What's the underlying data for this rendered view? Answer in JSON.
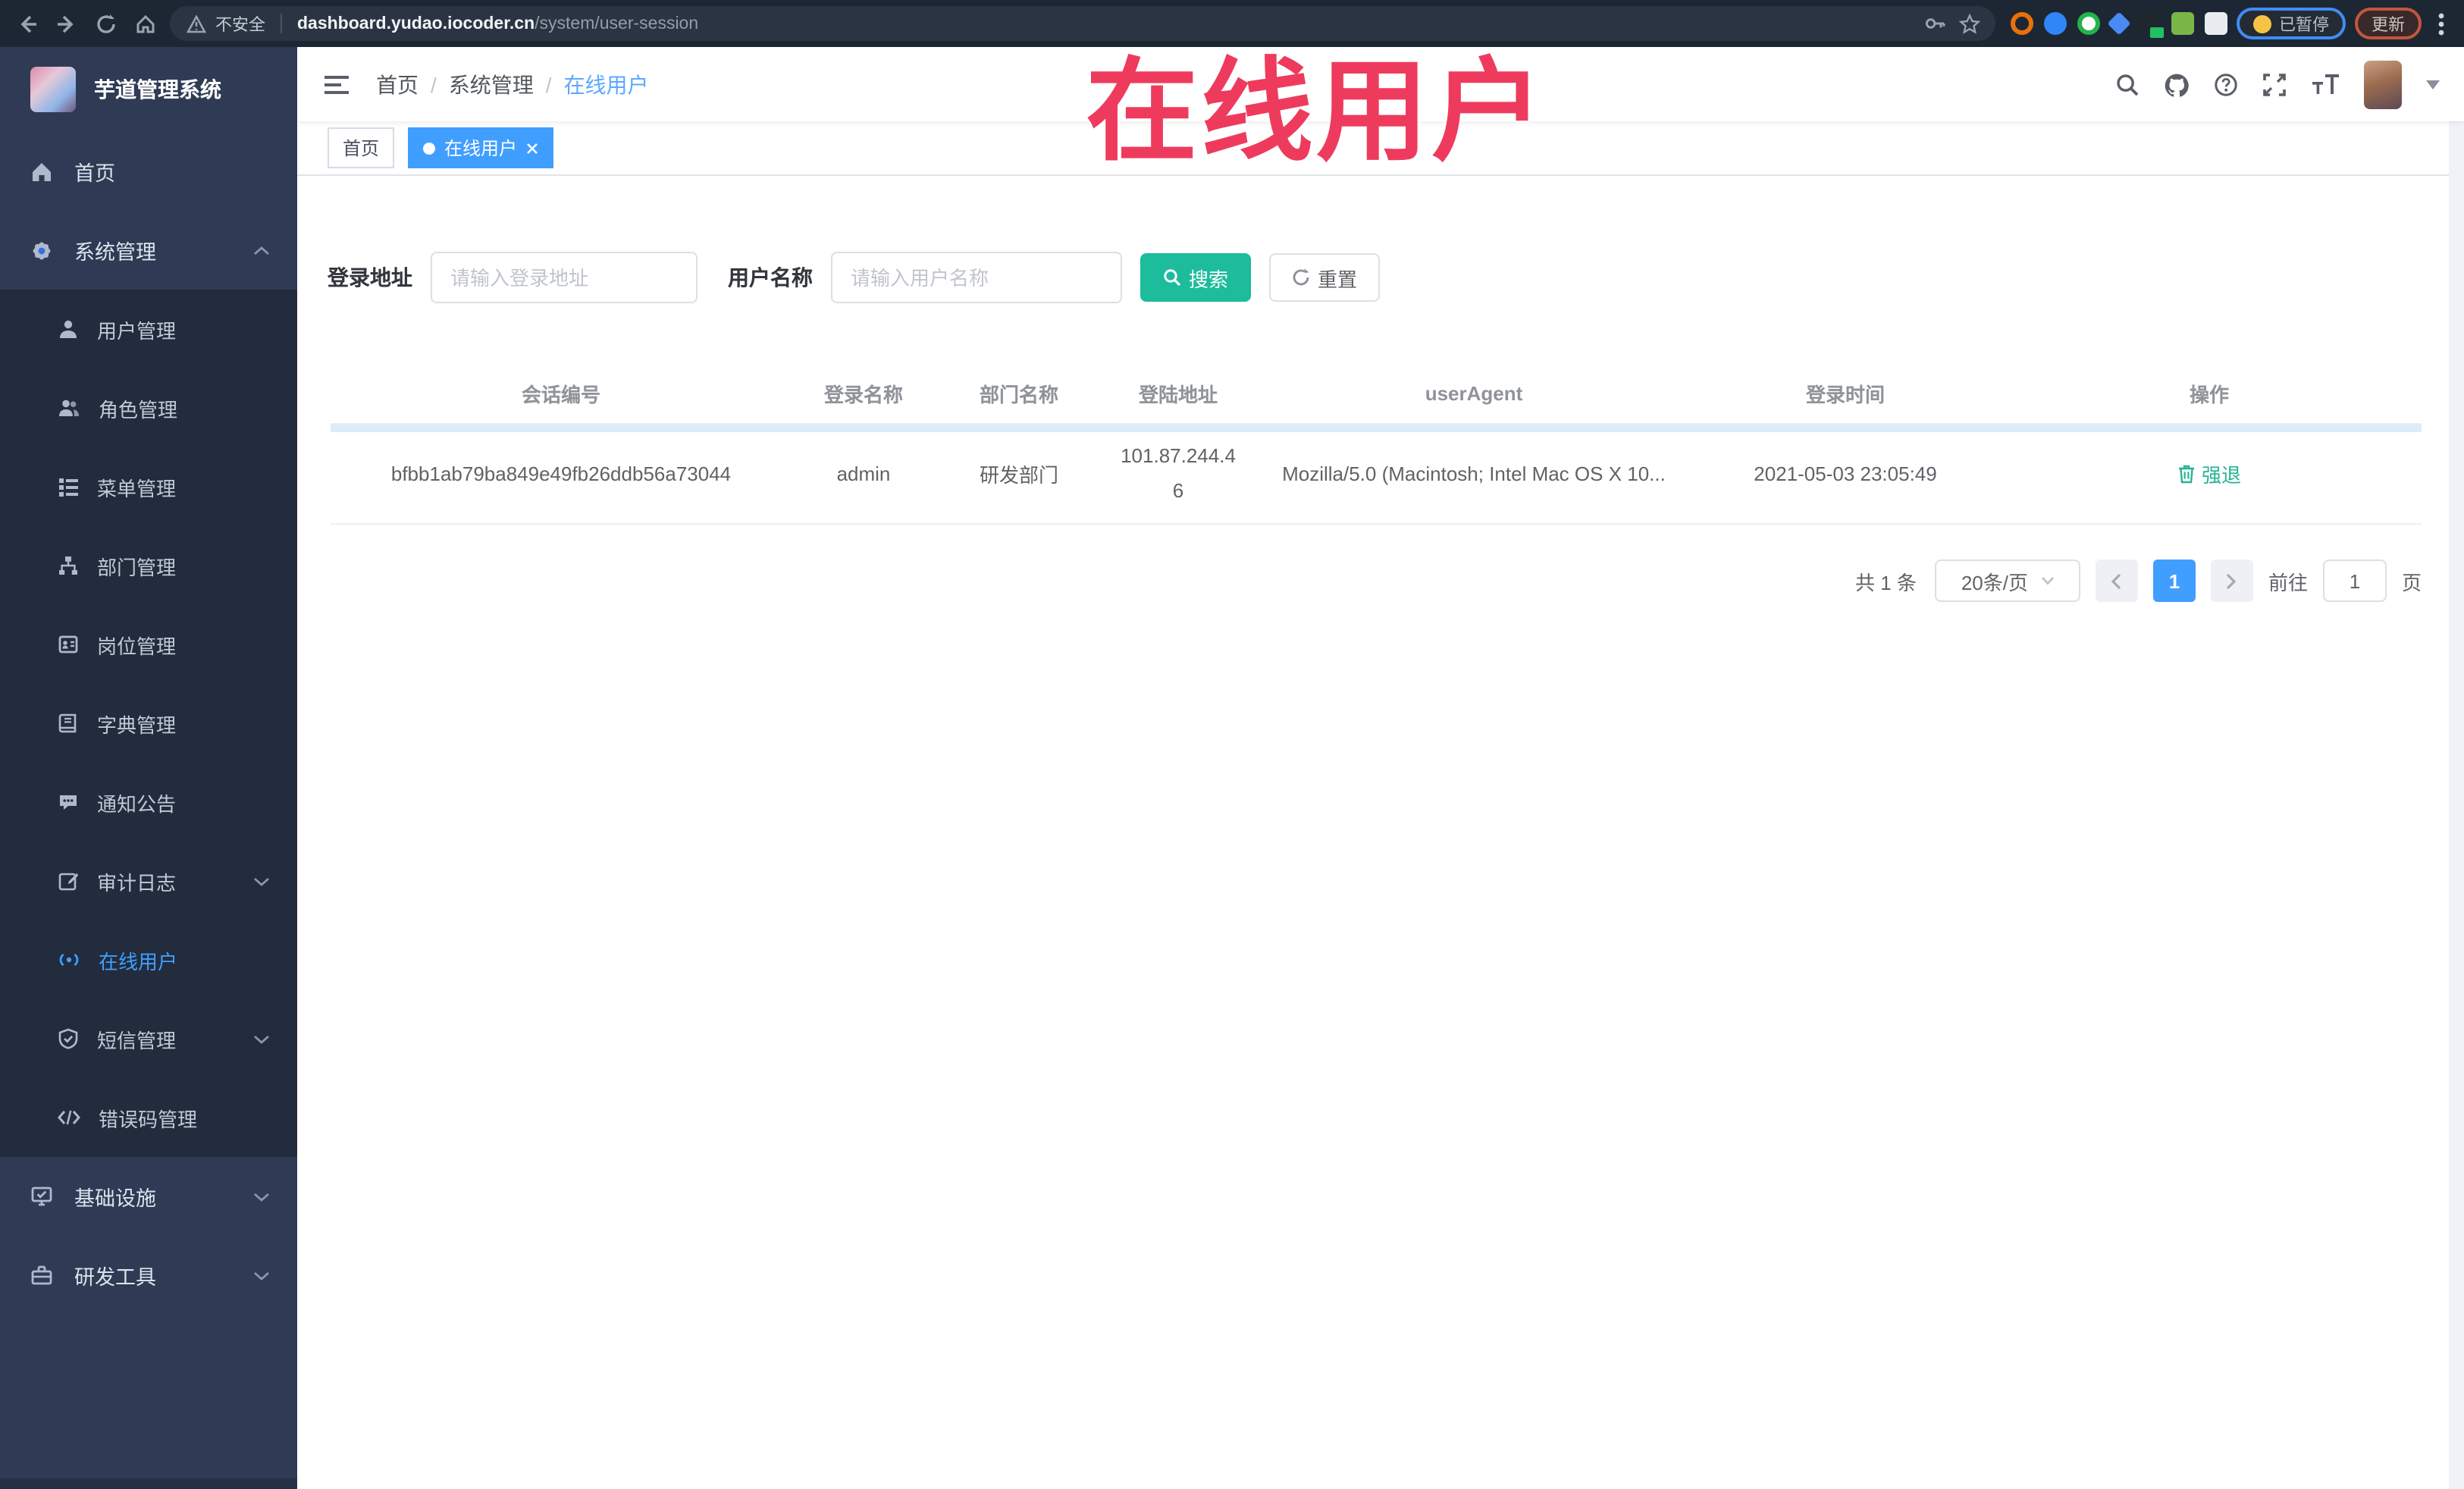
{
  "browser": {
    "security_label": "不安全",
    "url_domain": "dashboard.yudao.iocoder.cn",
    "url_path": "/system/user-session",
    "paused_label": "已暂停",
    "update_label": "更新"
  },
  "annotation": {
    "text": "在线用户",
    "color": "#ee3b5d"
  },
  "sidebar": {
    "title": "芋道管理系统",
    "items": [
      {
        "label": "首页",
        "icon": "home-icon",
        "level": "top"
      },
      {
        "label": "系统管理",
        "icon": "gear-icon",
        "level": "top",
        "chevron": "up"
      },
      {
        "label": "用户管理",
        "icon": "user-icon",
        "level": "sub"
      },
      {
        "label": "角色管理",
        "icon": "users-icon",
        "level": "sub"
      },
      {
        "label": "菜单管理",
        "icon": "menu-list-icon",
        "level": "sub"
      },
      {
        "label": "部门管理",
        "icon": "org-tree-icon",
        "level": "sub"
      },
      {
        "label": "岗位管理",
        "icon": "id-badge-icon",
        "level": "sub"
      },
      {
        "label": "字典管理",
        "icon": "dictionary-icon",
        "level": "sub"
      },
      {
        "label": "通知公告",
        "icon": "announcement-icon",
        "level": "sub"
      },
      {
        "label": "审计日志",
        "icon": "audit-log-icon",
        "level": "sub",
        "chevron": "down"
      },
      {
        "label": "在线用户",
        "icon": "online-user-icon",
        "level": "sub",
        "active": true
      },
      {
        "label": "短信管理",
        "icon": "sms-icon",
        "level": "sub",
        "chevron": "down"
      },
      {
        "label": "错误码管理",
        "icon": "error-code-icon",
        "level": "sub"
      },
      {
        "label": "基础设施",
        "icon": "infrastructure-icon",
        "level": "top",
        "chevron": "down"
      },
      {
        "label": "研发工具",
        "icon": "dev-tools-icon",
        "level": "top",
        "chevron": "down"
      }
    ]
  },
  "header": {
    "breadcrumb": [
      "首页",
      "系统管理",
      "在线用户"
    ],
    "breadcrumb_sep": "/"
  },
  "tags": {
    "home_label": "首页",
    "active_label": "在线用户"
  },
  "filters": {
    "login_address_label": "登录地址",
    "login_address_placeholder": "请输入登录地址",
    "username_label": "用户名称",
    "username_placeholder": "请输入用户名称",
    "search_label": "搜索",
    "reset_label": "重置"
  },
  "table": {
    "headers": [
      "会话编号",
      "登录名称",
      "部门名称",
      "登陆地址",
      "userAgent",
      "登录时间",
      "操作"
    ],
    "rows": [
      {
        "session_id": "bfbb1ab79ba849e49fb26ddb56a73044",
        "username": "admin",
        "dept": "研发部门",
        "login_ip": "101.87.244.46",
        "user_agent": "Mozilla/5.0 (Macintosh; Intel Mac OS X 10...",
        "login_time": "2021-05-03 23:05:49",
        "action_label": "强退"
      }
    ]
  },
  "pagination": {
    "total_label": "共 1 条",
    "page_size_label": "20条/页",
    "current_page": "1",
    "goto_label": "前往",
    "goto_value": "1",
    "page_unit_label": "页"
  },
  "colors": {
    "accent_blue": "#409eff",
    "teal_button": "#1cbc9c",
    "sidebar_bg": "#2f3b55",
    "submenu_bg": "#222c3c",
    "annotation_red": "#ee3b5d"
  }
}
